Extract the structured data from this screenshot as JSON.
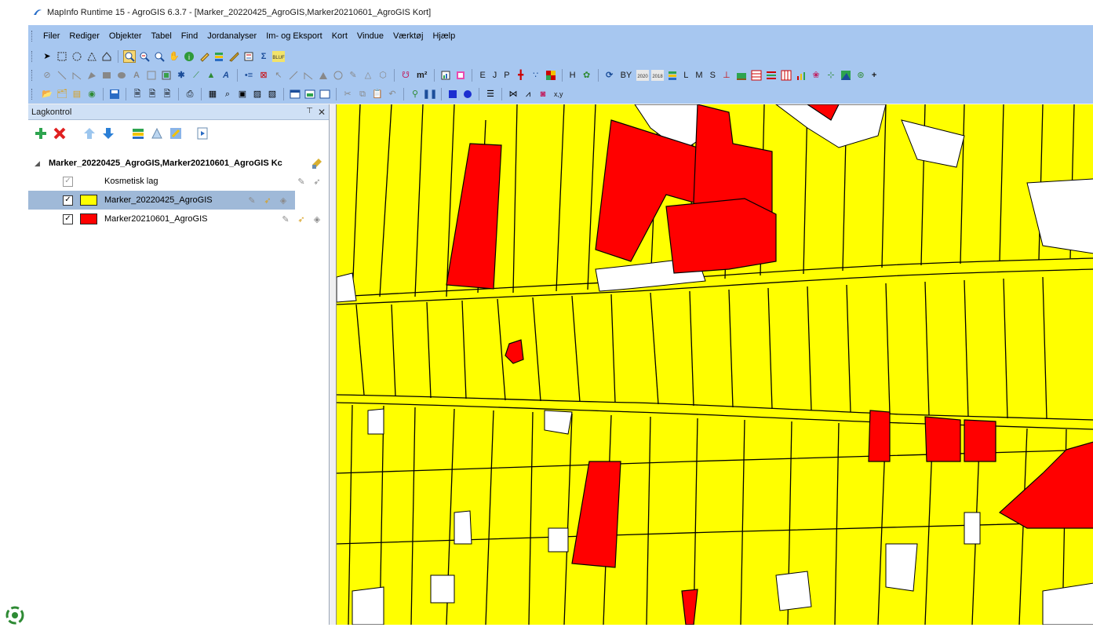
{
  "window": {
    "title": "MapInfo Runtime 15 - AgroGIS 6.3.7 - [Marker_20220425_AgroGIS,Marker20210601_AgroGIS Kort]"
  },
  "menu": [
    {
      "label": "Filer"
    },
    {
      "label": "Rediger"
    },
    {
      "label": "Objekter"
    },
    {
      "label": "Tabel"
    },
    {
      "label": "Find"
    },
    {
      "label": "Jordanalyser"
    },
    {
      "label": "Im- og Eksport"
    },
    {
      "label": "Kort"
    },
    {
      "label": "Vindue"
    },
    {
      "label": "Værktøj"
    },
    {
      "label": "Hjælp"
    }
  ],
  "toolbar_text": {
    "e": "E",
    "j": "J",
    "p": "P",
    "h": "H",
    "by": "BY",
    "l": "L",
    "m": "M",
    "s": "S",
    "plus": "+",
    "m2": "m²",
    "xy": "x,y"
  },
  "layer_panel": {
    "title": "Lagkontrol",
    "pin_symbol": "📌",
    "close_symbol": "✕",
    "root_label": "Marker_20220425_AgroGIS,Marker20210601_AgroGIS Kc",
    "layers": [
      {
        "label": "Kosmetisk lag",
        "checked": true,
        "enabled": false,
        "swatch": "none"
      },
      {
        "label": "Marker_20220425_AgroGIS",
        "checked": true,
        "enabled": true,
        "swatch": "#ffff00",
        "selected": true
      },
      {
        "label": "Marker20210601_AgroGIS",
        "checked": true,
        "enabled": true,
        "swatch": "#ff0000"
      }
    ]
  },
  "colors": {
    "field_yellow": "#ffff00",
    "field_red": "#ff0000",
    "toolbar_blue": "#a7c7f0",
    "selection": "#9fb9d8"
  }
}
